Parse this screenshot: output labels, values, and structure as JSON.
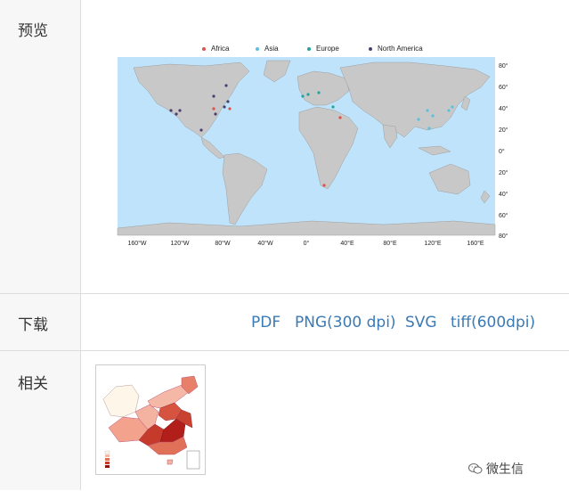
{
  "rows": {
    "preview_label": "预览",
    "download_label": "下载",
    "related_label": "相关"
  },
  "legend": [
    {
      "name": "Africa",
      "color": "#d9534f"
    },
    {
      "name": "Asia",
      "color": "#5bc0de"
    },
    {
      "name": "Europe",
      "color": "#20a59a"
    },
    {
      "name": "North America",
      "color": "#4b3f72"
    }
  ],
  "map": {
    "lat_ticks": [
      "80°N",
      "60°N",
      "40°N",
      "20°N",
      "0°",
      "20°S",
      "40°S",
      "60°S",
      "80°S"
    ],
    "lon_ticks": [
      "160°W",
      "120°W",
      "80°W",
      "40°W",
      "0°",
      "40°E",
      "80°E",
      "120°E",
      "160°E"
    ],
    "ocean_color": "#bfe3fb",
    "land_color": "#c8c8c8"
  },
  "downloads": [
    {
      "label": "PDF"
    },
    {
      "label": "PNG(300 dpi)"
    },
    {
      "label": "SVG"
    },
    {
      "label": "tiff(600dpi)"
    }
  ],
  "watermark": "微生信"
}
